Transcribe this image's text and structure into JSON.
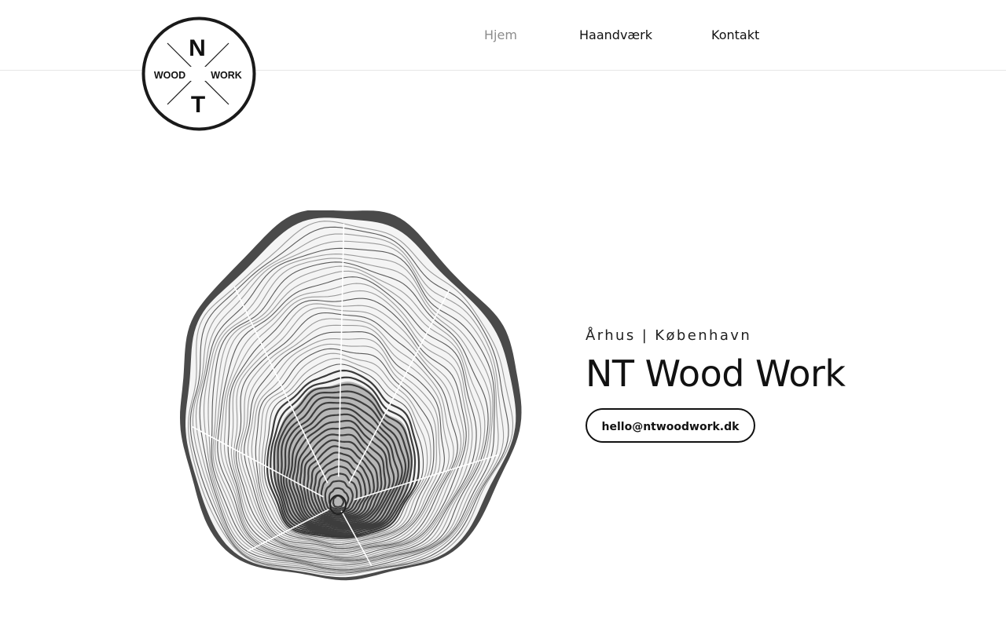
{
  "brand": {
    "logo_top_letter": "N",
    "logo_bottom_letter": "T",
    "logo_left_word": "WOOD",
    "logo_right_word": "WORK"
  },
  "nav": {
    "items": [
      {
        "label": "Hjem",
        "active": true
      },
      {
        "label": "Haandværk",
        "active": false
      },
      {
        "label": "Kontakt",
        "active": false
      }
    ]
  },
  "hero": {
    "subtitle": "Århus | København",
    "title": "NT Wood Work",
    "email_button": "hello@ntwoodwork.dk",
    "image_icon": "tree-rings-icon"
  },
  "colors": {
    "text": "#111111",
    "nav_active": "#8c8c8c",
    "divider": "#e6e6e6"
  }
}
